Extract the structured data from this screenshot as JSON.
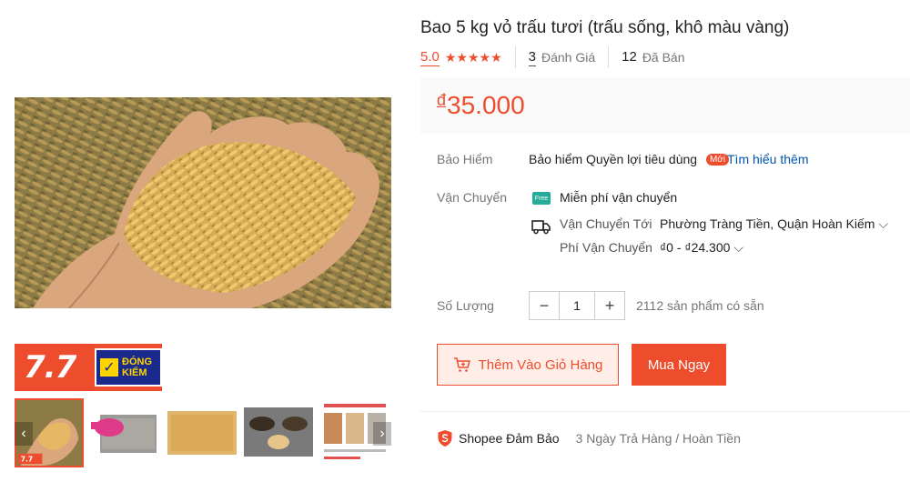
{
  "product": {
    "title": "Bao 5 kg vỏ trấu tươi (trấu sống, khô màu vàng)",
    "rating": "5.0",
    "stars": "★★★★★",
    "reviews_count": "3",
    "reviews_label": "Đánh Giá",
    "sold_count": "12",
    "sold_label": "Đã Bán",
    "price_currency": "đ",
    "price": "35.000"
  },
  "badge": {
    "sale_label": "7.7",
    "check_mark": "✓",
    "line1": "ĐÓNG",
    "line2": "KIỂM"
  },
  "gallery": {
    "prev": "‹",
    "next": "›",
    "thumb_count": 5,
    "thumb_badge": "7.7"
  },
  "insurance": {
    "label": "Bảo Hiểm",
    "text": "Bảo hiểm Quyền lợi tiêu dùng",
    "tag": "Mới",
    "link": "Tìm hiểu thêm"
  },
  "shipping": {
    "label": "Vận Chuyển",
    "free_icon_text": "Free",
    "free_text": "Miễn phí vận chuyển",
    "to_label": "Vận Chuyển Tới",
    "to_value": "Phường Tràng Tiền, Quận Hoàn Kiếm",
    "fee_label": "Phí Vận Chuyển",
    "fee_value": "₫0 - ₫24.300",
    "chevron": "⌵"
  },
  "quantity": {
    "label": "Số Lượng",
    "minus": "−",
    "value": "1",
    "plus": "+",
    "stock": "2112 sản phẩm có sẵn"
  },
  "actions": {
    "add_to_cart": "Thêm Vào Giỏ Hàng",
    "buy_now": "Mua Ngay"
  },
  "guarantee": {
    "title": "Shopee Đảm Bảo",
    "sub": "3 Ngày Trả Hàng / Hoàn Tiền"
  },
  "colors": {
    "accent": "#ee4d2d",
    "link": "#0055aa",
    "free_ship": "#26aa99"
  }
}
